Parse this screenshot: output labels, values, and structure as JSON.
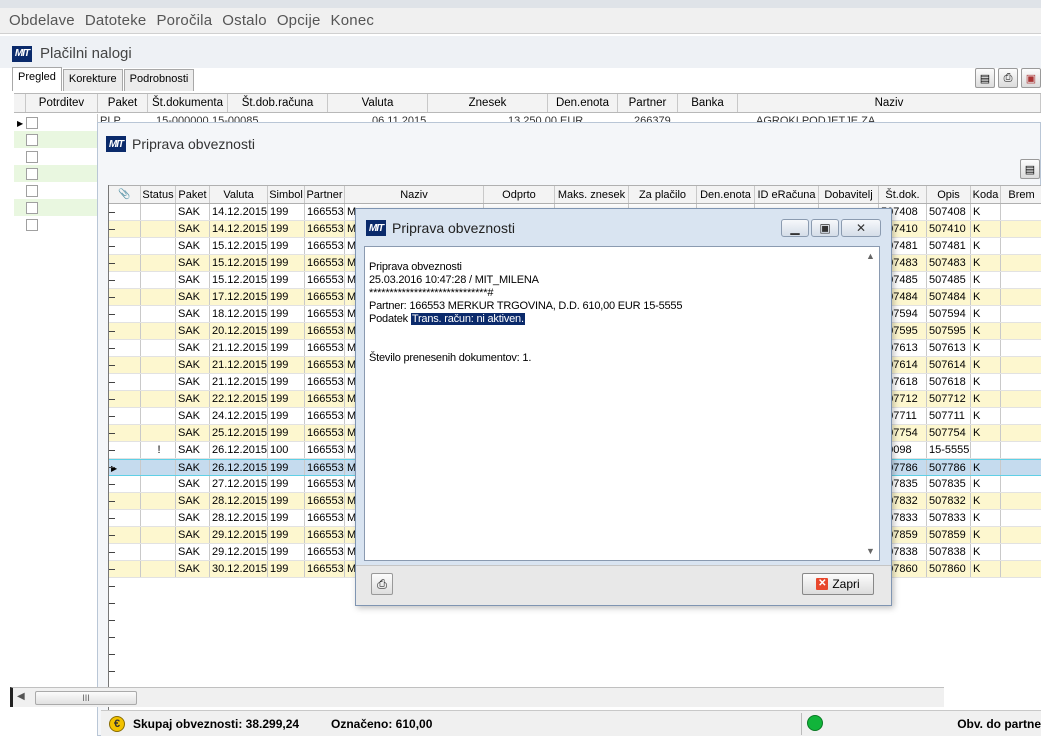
{
  "menu": [
    "Obdelave",
    "Datoteke",
    "Poročila",
    "Ostalo",
    "Opcije",
    "Konec"
  ],
  "outer": {
    "logo": "MIT",
    "title": "Plačilni nalogi",
    "tabs": [
      "Pregled",
      "Korekture",
      "Podrobnosti"
    ],
    "columns": [
      "Potrditev",
      "Paket",
      "Št.dokumenta",
      "Št.dob.računa",
      "Valuta",
      "Znesek",
      "Den.enota",
      "Partner",
      "Banka",
      "Naziv"
    ],
    "first_row": [
      "PLP",
      "15-000000",
      "15-00085",
      "06.11.2015",
      "13.250,00",
      "EUR",
      "266379",
      "AGROKI PODJETJE ZA"
    ]
  },
  "inner": {
    "logo": "MIT",
    "title": "Priprava obveznosti",
    "columns": [
      "",
      "Status",
      "Paket",
      "Valuta",
      "Simbol",
      "Partner",
      "Naziv",
      "Odprto",
      "Maks. znesek",
      "Za plačilo",
      "Den.enota",
      "ID eRačuna",
      "Dobavitelj",
      "Št.dok.",
      "Opis",
      "Koda",
      "Brem"
    ],
    "rows": [
      {
        "status": "",
        "paket": "SAK",
        "valuta": "14.12.2015",
        "simbol": "199",
        "partner": "166553",
        "naziv": "M",
        "stdok": "507408",
        "opis": "507408",
        "koda": "K",
        "style": "white"
      },
      {
        "status": "",
        "paket": "SAK",
        "valuta": "14.12.2015",
        "simbol": "199",
        "partner": "166553",
        "naziv": "M",
        "stdok": "507410",
        "opis": "507410",
        "koda": "K",
        "style": "yellow"
      },
      {
        "status": "",
        "paket": "SAK",
        "valuta": "15.12.2015",
        "simbol": "199",
        "partner": "166553",
        "naziv": "M",
        "stdok": "507481",
        "opis": "507481",
        "koda": "K",
        "style": "white"
      },
      {
        "status": "",
        "paket": "SAK",
        "valuta": "15.12.2015",
        "simbol": "199",
        "partner": "166553",
        "naziv": "M",
        "stdok": "507483",
        "opis": "507483",
        "koda": "K",
        "style": "yellow"
      },
      {
        "status": "",
        "paket": "SAK",
        "valuta": "15.12.2015",
        "simbol": "199",
        "partner": "166553",
        "naziv": "M",
        "stdok": "507485",
        "opis": "507485",
        "koda": "K",
        "style": "white"
      },
      {
        "status": "",
        "paket": "SAK",
        "valuta": "17.12.2015",
        "simbol": "199",
        "partner": "166553",
        "naziv": "M",
        "stdok": "507484",
        "opis": "507484",
        "koda": "K",
        "style": "yellow"
      },
      {
        "status": "",
        "paket": "SAK",
        "valuta": "18.12.2015",
        "simbol": "199",
        "partner": "166553",
        "naziv": "M",
        "stdok": "507594",
        "opis": "507594",
        "koda": "K",
        "style": "white"
      },
      {
        "status": "",
        "paket": "SAK",
        "valuta": "20.12.2015",
        "simbol": "199",
        "partner": "166553",
        "naziv": "M",
        "stdok": "507595",
        "opis": "507595",
        "koda": "K",
        "style": "yellow"
      },
      {
        "status": "",
        "paket": "SAK",
        "valuta": "21.12.2015",
        "simbol": "199",
        "partner": "166553",
        "naziv": "M",
        "stdok": "507613",
        "opis": "507613",
        "koda": "K",
        "style": "white"
      },
      {
        "status": "",
        "paket": "SAK",
        "valuta": "21.12.2015",
        "simbol": "199",
        "partner": "166553",
        "naziv": "M",
        "stdok": "507614",
        "opis": "507614",
        "koda": "K",
        "style": "yellow"
      },
      {
        "status": "",
        "paket": "SAK",
        "valuta": "21.12.2015",
        "simbol": "199",
        "partner": "166553",
        "naziv": "M",
        "stdok": "507618",
        "opis": "507618",
        "koda": "K",
        "style": "white"
      },
      {
        "status": "",
        "paket": "SAK",
        "valuta": "22.12.2015",
        "simbol": "199",
        "partner": "166553",
        "naziv": "M",
        "stdok": "507712",
        "opis": "507712",
        "koda": "K",
        "style": "yellow"
      },
      {
        "status": "",
        "paket": "SAK",
        "valuta": "24.12.2015",
        "simbol": "199",
        "partner": "166553",
        "naziv": "M",
        "stdok": "507711",
        "opis": "507711",
        "koda": "K",
        "style": "white"
      },
      {
        "status": "",
        "paket": "SAK",
        "valuta": "25.12.2015",
        "simbol": "199",
        "partner": "166553",
        "naziv": "M",
        "stdok": "507754",
        "opis": "507754",
        "koda": "K",
        "style": "yellow"
      },
      {
        "status": "!",
        "paket": "SAK",
        "valuta": "26.12.2015",
        "simbol": "100",
        "partner": "166553",
        "naziv": "M",
        "stdok": "00098",
        "opis": "15-5555",
        "koda": "",
        "style": "white"
      },
      {
        "status": "",
        "paket": "SAK",
        "valuta": "26.12.2015",
        "simbol": "199",
        "partner": "166553",
        "naziv": "M",
        "stdok": "507786",
        "opis": "507786",
        "koda": "K",
        "style": "sel"
      },
      {
        "status": "",
        "paket": "SAK",
        "valuta": "27.12.2015",
        "simbol": "199",
        "partner": "166553",
        "naziv": "M",
        "stdok": "507835",
        "opis": "507835",
        "koda": "K",
        "style": "white"
      },
      {
        "status": "",
        "paket": "SAK",
        "valuta": "28.12.2015",
        "simbol": "199",
        "partner": "166553",
        "naziv": "M",
        "stdok": "507832",
        "opis": "507832",
        "koda": "K",
        "style": "yellow"
      },
      {
        "status": "",
        "paket": "SAK",
        "valuta": "28.12.2015",
        "simbol": "199",
        "partner": "166553",
        "naziv": "M",
        "stdok": "507833",
        "opis": "507833",
        "koda": "K",
        "style": "white"
      },
      {
        "status": "",
        "paket": "SAK",
        "valuta": "29.12.2015",
        "simbol": "199",
        "partner": "166553",
        "naziv": "M",
        "stdok": "507859",
        "opis": "507859",
        "koda": "K",
        "style": "yellow"
      },
      {
        "status": "",
        "paket": "SAK",
        "valuta": "29.12.2015",
        "simbol": "199",
        "partner": "166553",
        "naziv": "M",
        "stdok": "507838",
        "opis": "507838",
        "koda": "K",
        "style": "white"
      },
      {
        "status": "",
        "paket": "SAK",
        "valuta": "30.12.2015",
        "simbol": "199",
        "partner": "166553",
        "naziv": "M",
        "stdok": "507860",
        "opis": "507860",
        "koda": "K",
        "style": "yellow"
      }
    ],
    "scroll_thumb": "III",
    "status": {
      "total": "Skupaj obveznosti: 38.299,24",
      "marked": "Označeno: 610,00",
      "right": "Obv. do partne"
    }
  },
  "dialog": {
    "logo": "MIT",
    "title": "Priprava obveznosti",
    "lines": [
      "Priprava obveznosti",
      "25.03.2016 10:47:28 / MIT_MILENA",
      "*****************************#",
      "Partner: 166553  MERKUR TRGOVINA, D.D. 610,00 EUR   15-5555",
      "",
      "",
      "",
      "Število prenesenih dokumentov: 1."
    ],
    "data_prefix": "Podatek ",
    "data_highlight": "Trans. račun:  ni aktiven.",
    "close_label": "Zapri"
  },
  "colors": {
    "row_yellow": "#fdf7cf",
    "row_selected": "#c5dbee",
    "logo_blue": "#0a2a6b",
    "status_led": "#11b43a"
  }
}
